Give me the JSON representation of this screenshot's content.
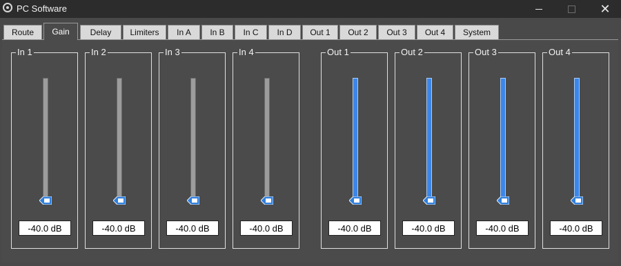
{
  "window": {
    "title": "PC Software",
    "icon": "app-logo-icon",
    "controls": {
      "minimize_icon": "minimize-icon",
      "maximize_icon": "maximize-icon",
      "close_icon": "close-icon",
      "close_glyph": "✕"
    }
  },
  "tabs": [
    {
      "label": "Route",
      "active": false
    },
    {
      "label": "Gain",
      "active": true
    },
    {
      "label": "Delay",
      "active": false
    },
    {
      "label": "Limiters",
      "active": false
    },
    {
      "label": "In A",
      "active": false
    },
    {
      "label": "In B",
      "active": false
    },
    {
      "label": "In C",
      "active": false
    },
    {
      "label": "In D",
      "active": false
    },
    {
      "label": "Out 1",
      "active": false
    },
    {
      "label": "Out 2",
      "active": false
    },
    {
      "label": "Out 3",
      "active": false
    },
    {
      "label": "Out 4",
      "active": false
    },
    {
      "label": "System",
      "active": false
    }
  ],
  "gain": {
    "inputs": [
      {
        "label": "In 1",
        "value": "-40.0 dB"
      },
      {
        "label": "In 2",
        "value": "-40.0 dB"
      },
      {
        "label": "In 3",
        "value": "-40.0 dB"
      },
      {
        "label": "In 4",
        "value": "-40.0 dB"
      }
    ],
    "outputs": [
      {
        "label": "Out 1",
        "value": "-40.0 dB"
      },
      {
        "label": "Out 2",
        "value": "-40.0 dB"
      },
      {
        "label": "Out 3",
        "value": "-40.0 dB"
      },
      {
        "label": "Out 4",
        "value": "-40.0 dB"
      }
    ],
    "slider_level": 0.0
  },
  "colors": {
    "input_track": "#9c9c9c",
    "output_track": "#3b86e8",
    "thumb": "#2f7fdc",
    "background": "#494949"
  }
}
